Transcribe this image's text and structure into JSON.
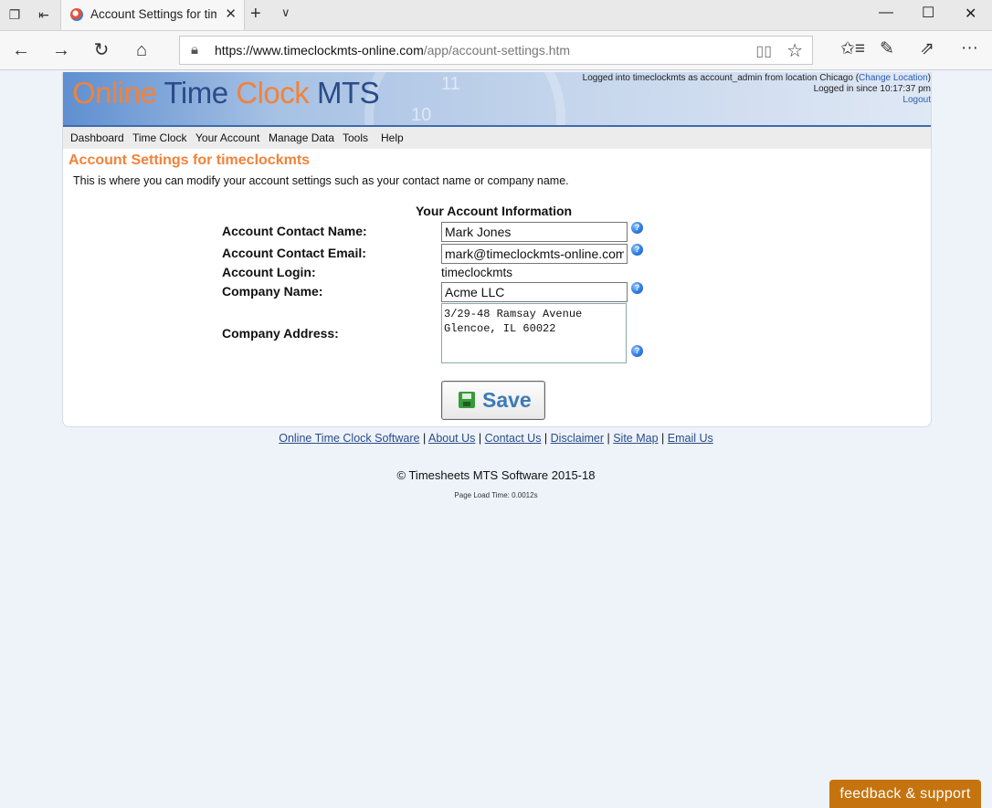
{
  "browser": {
    "tab_title": "Account Settings for timeclockmts",
    "url_host": "https://www.timeclockmts-online.com",
    "url_path": "/app/account-settings.htm"
  },
  "site": {
    "logo": {
      "online": "Online",
      "time": "Time",
      "clock": "Clock",
      "mts": "MTS"
    },
    "clock_numbers": [
      "11",
      "10"
    ],
    "login": {
      "line1_prefix": "Logged into timeclockmts as account_admin from location Chicago (",
      "change_location": "Change Location",
      "line1_suffix": ")",
      "line2": "Logged in since 10:17:37 pm",
      "logout": "Logout"
    },
    "menu": [
      "Dashboard",
      "Time Clock",
      "Your Account",
      "Manage Data",
      "Tools",
      "Help"
    ]
  },
  "content": {
    "heading": "Account Settings for timeclockmts",
    "description": "This is where you can modify your account settings such as your contact name or company name.",
    "section_title": "Your Account Information",
    "fields": {
      "contact_name_label": "Account Contact Name:",
      "contact_name_value": "Mark Jones",
      "contact_email_label": "Account Contact Email:",
      "contact_email_value": "mark@timeclockmts-online.com",
      "login_label": "Account Login:",
      "login_value": "timeclockmts",
      "company_name_label": "Company Name:",
      "company_name_value": "Acme LLC",
      "company_address_label": "Company Address:",
      "company_address_value": "3/29-48 Ramsay Avenue\nGlencoe, IL 60022"
    },
    "help_glyph": "?",
    "save_label": "Save"
  },
  "footer": {
    "links": [
      "Online Time Clock Software",
      "About Us",
      "Contact Us",
      "Disclaimer",
      "Site Map",
      "Email Us"
    ],
    "separator": " | ",
    "copyright": "© Timesheets MTS Software 2015-18",
    "load_time": "Page Load Time: 0.0012s"
  },
  "feedback_label": "feedback & support"
}
